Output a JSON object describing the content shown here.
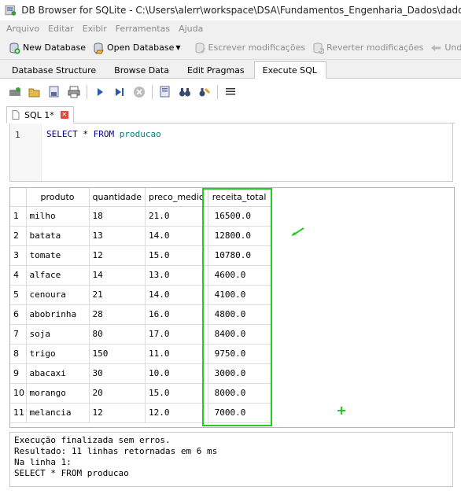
{
  "window": {
    "title": "DB Browser for SQLite - C:\\Users\\alerr\\workspace\\DSA\\Fundamentos_Engenharia_Dados\\dados.db"
  },
  "menu": [
    "Arquivo",
    "Editar",
    "Exibir",
    "Ferramentas",
    "Ajuda"
  ],
  "toolbar": {
    "new_database": "New Database",
    "open_database": "Open Database",
    "write_changes": "Escrever modificações",
    "revert_changes": "Reverter modificações",
    "undo": "Undo"
  },
  "tabs": [
    "Database Structure",
    "Browse Data",
    "Edit Pragmas",
    "Execute SQL"
  ],
  "active_tab": "Execute SQL",
  "sql_tab": {
    "label": "SQL 1*"
  },
  "editor": {
    "line_number": "1",
    "keyword_select": "SELECT",
    "star": " * ",
    "keyword_from": "FROM",
    "table": "producao"
  },
  "results": {
    "columns": [
      "produto",
      "quantidade",
      "preco_medio",
      "receita_total"
    ],
    "rows": [
      {
        "n": "1",
        "produto": "milho",
        "quantidade": "18",
        "preco_medio": "21.0",
        "receita_total": "16500.0"
      },
      {
        "n": "2",
        "produto": "batata",
        "quantidade": "13",
        "preco_medio": "14.0",
        "receita_total": "12800.0"
      },
      {
        "n": "3",
        "produto": "tomate",
        "quantidade": "12",
        "preco_medio": "15.0",
        "receita_total": "10780.0"
      },
      {
        "n": "4",
        "produto": "alface",
        "quantidade": "14",
        "preco_medio": "13.0",
        "receita_total": "4600.0"
      },
      {
        "n": "5",
        "produto": "cenoura",
        "quantidade": "21",
        "preco_medio": "14.0",
        "receita_total": "4100.0"
      },
      {
        "n": "6",
        "produto": "abobrinha",
        "quantidade": "28",
        "preco_medio": "16.0",
        "receita_total": "4800.0"
      },
      {
        "n": "7",
        "produto": "soja",
        "quantidade": "80",
        "preco_medio": "17.0",
        "receita_total": "8400.0"
      },
      {
        "n": "8",
        "produto": "trigo",
        "quantidade": "150",
        "preco_medio": "11.0",
        "receita_total": "9750.0"
      },
      {
        "n": "9",
        "produto": "abacaxi",
        "quantidade": "30",
        "preco_medio": "10.0",
        "receita_total": "3000.0"
      },
      {
        "n": "10",
        "produto": "morango",
        "quantidade": "20",
        "preco_medio": "15.0",
        "receita_total": "8000.0"
      },
      {
        "n": "11",
        "produto": "melancia",
        "quantidade": "12",
        "preco_medio": "12.0",
        "receita_total": "7000.0"
      }
    ]
  },
  "messages": [
    "Execução finalizada sem erros.",
    "Resultado: 11 linhas retornadas em 6 ms",
    "Na linha 1:",
    "SELECT * FROM producao"
  ],
  "colors": {
    "highlight": "#22cc22",
    "sql_keyword": "#00008b",
    "sql_identifier": "#008080"
  }
}
